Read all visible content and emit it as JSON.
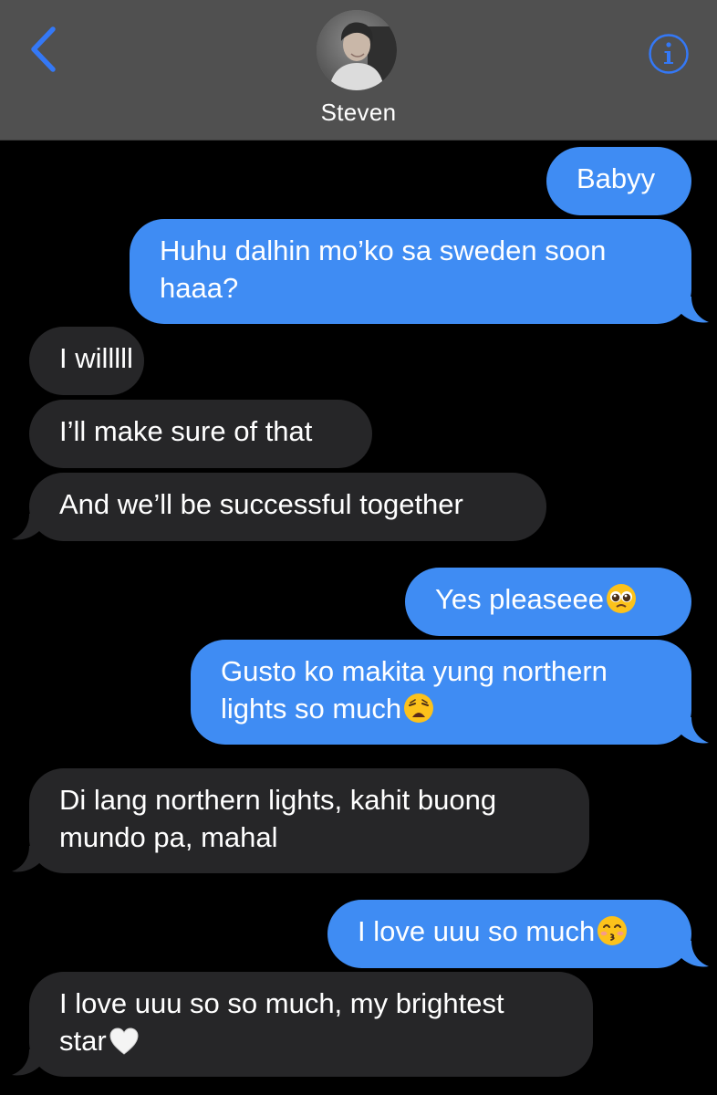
{
  "header": {
    "back_icon": "chevron-left-icon",
    "info_icon": "info-circle-icon",
    "contact_name": "Steven",
    "accent_color": "#3478f6",
    "background_color": "#505050"
  },
  "colors": {
    "sent_bubble": "#3f8cf3",
    "received_bubble": "#262628",
    "background": "#000000"
  },
  "messages": [
    {
      "direction": "sent",
      "lines": [
        "Babyy"
      ]
    },
    {
      "direction": "sent",
      "lines": [
        "Huhu dalhin mo’ko sa sweden soon",
        "haaa?"
      ]
    },
    {
      "direction": "received",
      "lines": [
        "I willlll"
      ]
    },
    {
      "direction": "received",
      "lines": [
        "I’ll make sure of that"
      ]
    },
    {
      "direction": "received",
      "lines": [
        "And we’ll be successful together"
      ]
    },
    {
      "direction": "sent",
      "lines": [
        "Yes pleaseee"
      ],
      "emoji": "pleading-face-icon"
    },
    {
      "direction": "sent",
      "lines": [
        "Gusto ko makita yung northern",
        "lights so much"
      ],
      "emoji": "weary-face-icon"
    },
    {
      "direction": "received",
      "lines": [
        "Di lang northern lights, kahit buong",
        "mundo pa, mahal"
      ]
    },
    {
      "direction": "sent",
      "lines": [
        "I love uuu so much"
      ],
      "emoji": "kissing-face-icon"
    },
    {
      "direction": "received",
      "lines": [
        "I love uuu so so much, my brightest",
        "star"
      ],
      "emoji": "white-heart-icon"
    }
  ]
}
